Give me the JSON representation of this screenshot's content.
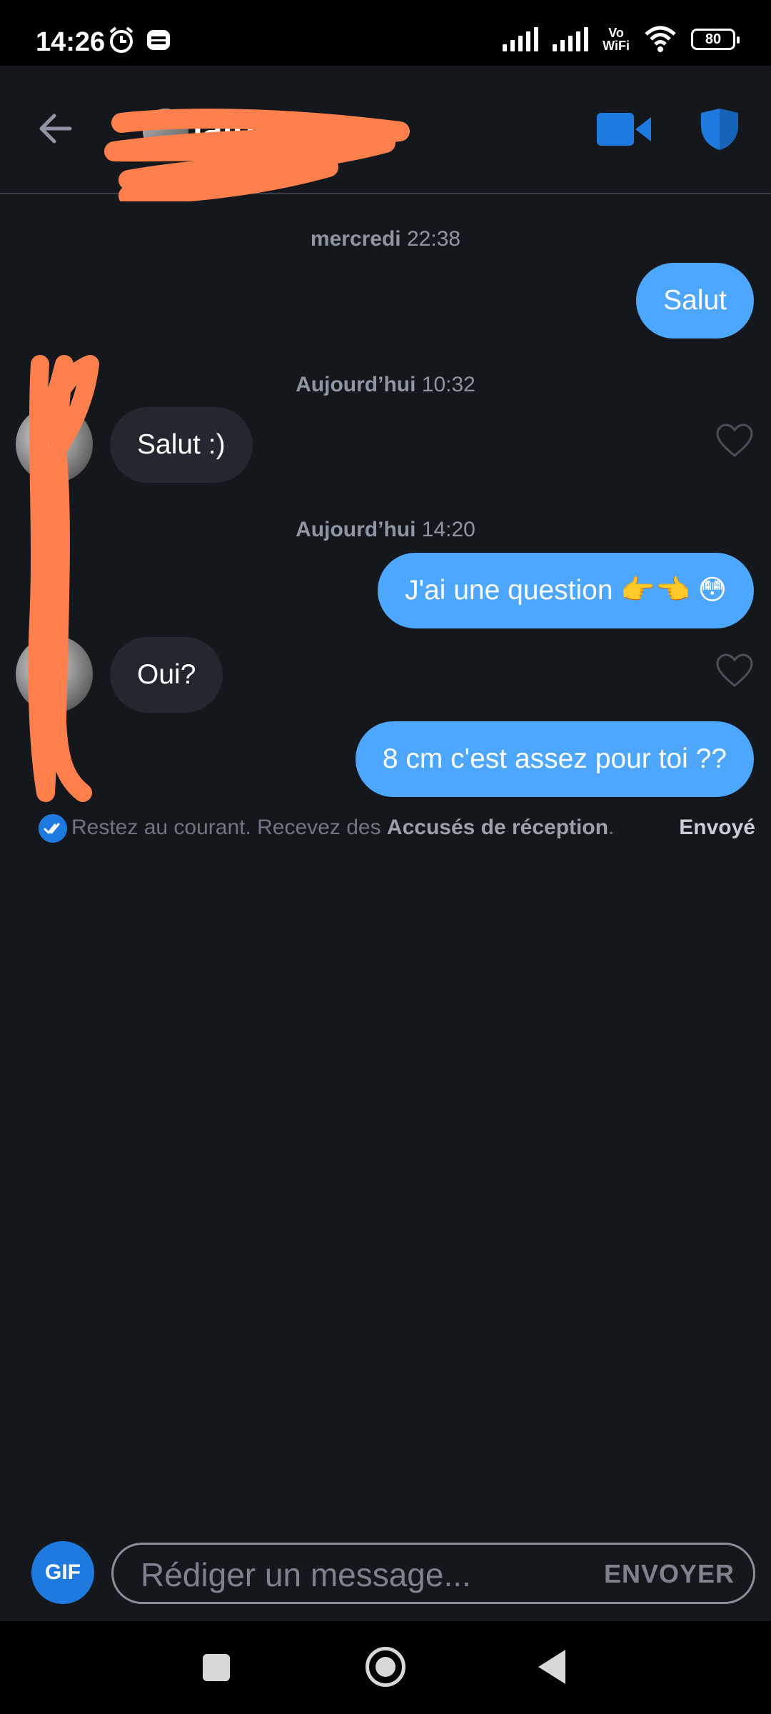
{
  "status_bar": {
    "time": "14:26",
    "vowifi_top": "Vo",
    "vowifi_bottom": "WiFi",
    "battery": "80"
  },
  "header": {
    "contact_name": "laire",
    "icons": [
      "back-arrow-icon",
      "video-call-icon",
      "shield-icon"
    ],
    "accent_color": "#1f7ae0"
  },
  "conversation": {
    "timestamps": [
      {
        "day": "mercredi",
        "time": "22:38"
      },
      {
        "day": "Aujourd’hui",
        "time": "10:32"
      },
      {
        "day": "Aujourd’hui",
        "time": "14:20"
      }
    ],
    "messages": [
      {
        "direction": "out",
        "text": "Salut"
      },
      {
        "direction": "in",
        "text": "Salut :)"
      },
      {
        "direction": "out",
        "text": "J'ai une question 👉👈 😳"
      },
      {
        "direction": "in",
        "text": "Oui?"
      },
      {
        "direction": "out",
        "text": "8 cm c'est assez pour toi ??"
      }
    ],
    "receipt": {
      "text_before": "Restez au courant. Recevez des ",
      "link": "Accusés de réception",
      "text_after": ".",
      "status": "Envoyé"
    }
  },
  "composer": {
    "gif_label": "GIF",
    "placeholder": "Rédiger un message...",
    "send_label": "ENVOYER"
  },
  "colors": {
    "background": "#14171c",
    "outgoing_bubble": "#4da6ff",
    "incoming_bubble": "#232730",
    "redaction": "#ff7f4d"
  }
}
